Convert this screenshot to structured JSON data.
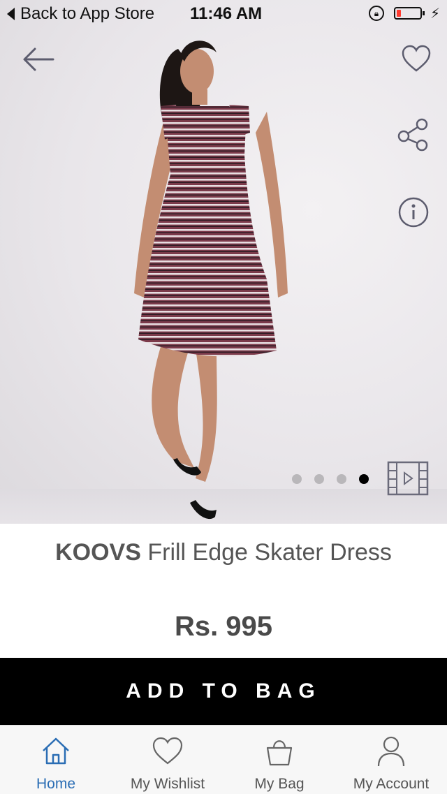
{
  "status_bar": {
    "back_label": "Back to App Store",
    "time": "11:46 AM",
    "battery_level": 0.2,
    "battery_color": "#ff3b30"
  },
  "hero": {
    "icons": [
      "back-arrow-icon",
      "heart-icon",
      "share-icon",
      "info-icon",
      "video-icon"
    ],
    "carousel": {
      "count": 4,
      "active_index": 4
    }
  },
  "product": {
    "brand": "KOOVS",
    "name": "Frill Edge Skater Dress",
    "price": "Rs. 995"
  },
  "actions": {
    "add_to_bag": "ADD TO BAG"
  },
  "tabbar": {
    "items": [
      {
        "label": "Home",
        "icon": "home-icon",
        "active": true
      },
      {
        "label": "My Wishlist",
        "icon": "heart-icon",
        "active": false
      },
      {
        "label": "My Bag",
        "icon": "bag-icon",
        "active": false
      },
      {
        "label": "My Account",
        "icon": "person-icon",
        "active": false
      }
    ],
    "active_color": "#2a6db4"
  }
}
